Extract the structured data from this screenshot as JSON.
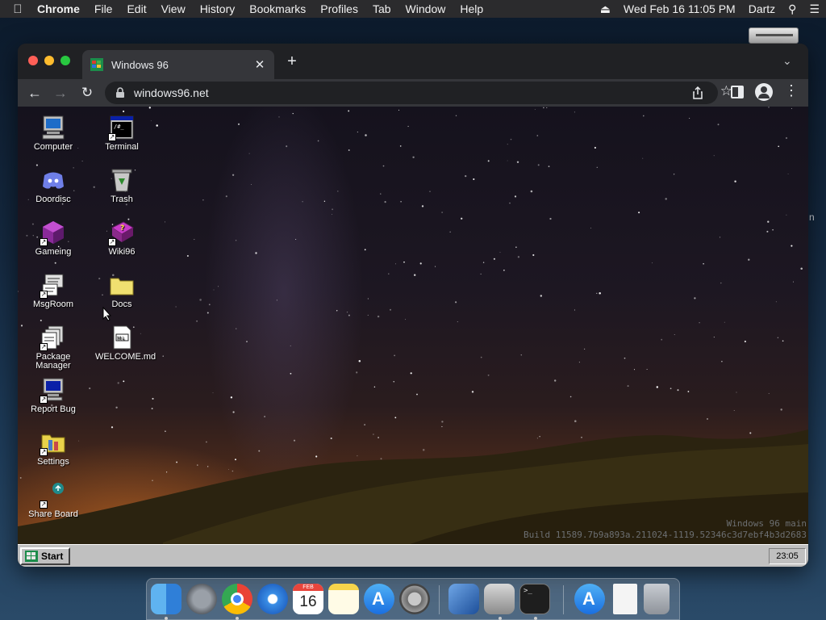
{
  "menubar": {
    "app_name": "Chrome",
    "items": [
      "File",
      "Edit",
      "View",
      "History",
      "Bookmarks",
      "Profiles",
      "Tab",
      "Window",
      "Help"
    ],
    "datetime": "Wed Feb 16  11:05 PM",
    "user": "Dartz"
  },
  "desktop": {
    "edge_text": "n"
  },
  "browser": {
    "tab_title": "Windows 96",
    "url": "windows96.net"
  },
  "win96": {
    "icons_col1": [
      {
        "label": "Computer"
      },
      {
        "label": "Doordisc"
      },
      {
        "label": "Gameing"
      },
      {
        "label": "MsgRoom"
      },
      {
        "label": "Package Manager"
      },
      {
        "label": "Report Bug"
      },
      {
        "label": "Settings"
      },
      {
        "label": "Share Board"
      }
    ],
    "icons_col2": [
      {
        "label": "Terminal"
      },
      {
        "label": "Trash"
      },
      {
        "label": "Wiki96"
      },
      {
        "label": "Docs"
      },
      {
        "label": "WELCOME.md"
      }
    ],
    "build_line1": "Windows 96 main",
    "build_line2": "Build 11589.7b9a893a.211024-1119.52346c3d7ebf4b3d2683",
    "start_label": "Start",
    "clock": "23:05"
  },
  "dock": {
    "apps": [
      "Finder",
      "Launchpad",
      "Chrome",
      "Safari",
      "Calendar",
      "Notes",
      "App Store",
      "System Preferences",
      "VirtualBox",
      "Disk Utility",
      "Terminal",
      "App Store Downloads",
      "Document",
      "Trash"
    ],
    "calendar_month": "FEB",
    "calendar_day": "16"
  }
}
